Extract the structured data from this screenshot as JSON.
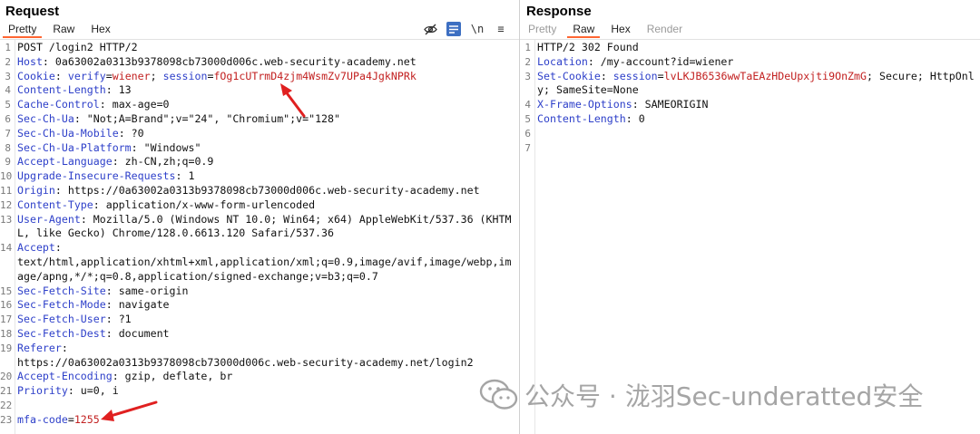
{
  "request": {
    "title": "Request",
    "tabs": [
      "Pretty",
      "Raw",
      "Hex"
    ],
    "active_tab": "Pretty",
    "toolbar": {
      "wrap_icon": "\\n",
      "menu_icon": "≡"
    },
    "lines": [
      {
        "n": "1",
        "parts": [
          {
            "t": "POST /login2 HTTP/2",
            "c": ""
          }
        ]
      },
      {
        "n": "2",
        "parts": [
          {
            "t": "Host",
            "c": "hk"
          },
          {
            "t": ": 0a63002a0313b9378098cb73000d006c.web-security-academy.net",
            "c": ""
          }
        ]
      },
      {
        "n": "3",
        "parts": [
          {
            "t": "Cookie",
            "c": "hk"
          },
          {
            "t": ": ",
            "c": ""
          },
          {
            "t": "verify",
            "c": "pk"
          },
          {
            "t": "=",
            "c": ""
          },
          {
            "t": "wiener",
            "c": "pv"
          },
          {
            "t": "; ",
            "c": ""
          },
          {
            "t": "session",
            "c": "pk"
          },
          {
            "t": "=",
            "c": ""
          },
          {
            "t": "fOg1cUTrmD4zjm4WsmZv7UPa4JgkNPRk",
            "c": "pv"
          }
        ]
      },
      {
        "n": "4",
        "parts": [
          {
            "t": "Content-Length",
            "c": "hk"
          },
          {
            "t": ": 13",
            "c": ""
          }
        ]
      },
      {
        "n": "5",
        "parts": [
          {
            "t": "Cache-Control",
            "c": "hk"
          },
          {
            "t": ": max-age=0",
            "c": ""
          }
        ]
      },
      {
        "n": "6",
        "parts": [
          {
            "t": "Sec-Ch-Ua",
            "c": "hk"
          },
          {
            "t": ": \"Not;A=Brand\";v=\"24\", \"Chromium\";v=\"128\"",
            "c": ""
          }
        ]
      },
      {
        "n": "7",
        "parts": [
          {
            "t": "Sec-Ch-Ua-Mobile",
            "c": "hk"
          },
          {
            "t": ": ?0",
            "c": ""
          }
        ]
      },
      {
        "n": "8",
        "parts": [
          {
            "t": "Sec-Ch-Ua-Platform",
            "c": "hk"
          },
          {
            "t": ": \"Windows\"",
            "c": ""
          }
        ]
      },
      {
        "n": "9",
        "parts": [
          {
            "t": "Accept-Language",
            "c": "hk"
          },
          {
            "t": ": zh-CN,zh;q=0.9",
            "c": ""
          }
        ]
      },
      {
        "n": "10",
        "parts": [
          {
            "t": "Upgrade-Insecure-Requests",
            "c": "hk"
          },
          {
            "t": ": 1",
            "c": ""
          }
        ]
      },
      {
        "n": "11",
        "parts": [
          {
            "t": "Origin",
            "c": "hk"
          },
          {
            "t": ": https://0a63002a0313b9378098cb73000d006c.web-security-academy.net",
            "c": ""
          }
        ]
      },
      {
        "n": "12",
        "parts": [
          {
            "t": "Content-Type",
            "c": "hk"
          },
          {
            "t": ": application/x-www-form-urlencoded",
            "c": ""
          }
        ]
      },
      {
        "n": "13",
        "parts": [
          {
            "t": "User-Agent",
            "c": "hk"
          },
          {
            "t": ": Mozilla/5.0 (Windows NT 10.0; Win64; x64) AppleWebKit/537.36 (KHTML, like Gecko) Chrome/128.0.6613.120 Safari/537.36",
            "c": ""
          }
        ]
      },
      {
        "n": "14",
        "parts": [
          {
            "t": "Accept",
            "c": "hk"
          },
          {
            "t": ":\ntext/html,application/xhtml+xml,application/xml;q=0.9,image/avif,image/webp,image/apng,*/*;q=0.8,application/signed-exchange;v=b3;q=0.7",
            "c": ""
          }
        ]
      },
      {
        "n": "15",
        "parts": [
          {
            "t": "Sec-Fetch-Site",
            "c": "hk"
          },
          {
            "t": ": same-origin",
            "c": ""
          }
        ]
      },
      {
        "n": "16",
        "parts": [
          {
            "t": "Sec-Fetch-Mode",
            "c": "hk"
          },
          {
            "t": ": navigate",
            "c": ""
          }
        ]
      },
      {
        "n": "17",
        "parts": [
          {
            "t": "Sec-Fetch-User",
            "c": "hk"
          },
          {
            "t": ": ?1",
            "c": ""
          }
        ]
      },
      {
        "n": "18",
        "parts": [
          {
            "t": "Sec-Fetch-Dest",
            "c": "hk"
          },
          {
            "t": ": document",
            "c": ""
          }
        ]
      },
      {
        "n": "19",
        "parts": [
          {
            "t": "Referer",
            "c": "hk"
          },
          {
            "t": ":\nhttps://0a63002a0313b9378098cb73000d006c.web-security-academy.net/login2",
            "c": ""
          }
        ]
      },
      {
        "n": "20",
        "parts": [
          {
            "t": "Accept-Encoding",
            "c": "hk"
          },
          {
            "t": ": gzip, deflate, br",
            "c": ""
          }
        ]
      },
      {
        "n": "21",
        "parts": [
          {
            "t": "Priority",
            "c": "hk"
          },
          {
            "t": ": u=0, i",
            "c": ""
          }
        ]
      },
      {
        "n": "22",
        "parts": [
          {
            "t": "",
            "c": ""
          }
        ]
      },
      {
        "n": "23",
        "parts": [
          {
            "t": "mfa-code",
            "c": "pk"
          },
          {
            "t": "=",
            "c": ""
          },
          {
            "t": "1255",
            "c": "pv"
          }
        ]
      }
    ]
  },
  "response": {
    "title": "Response",
    "tabs": [
      "Pretty",
      "Raw",
      "Hex",
      "Render"
    ],
    "active_tab": "Raw",
    "disabled_tabs": [
      "Pretty",
      "Render"
    ],
    "lines": [
      {
        "n": "1",
        "parts": [
          {
            "t": "HTTP/2 302 Found",
            "c": ""
          }
        ]
      },
      {
        "n": "2",
        "parts": [
          {
            "t": "Location",
            "c": "hk"
          },
          {
            "t": ": /my-account?id=wiener",
            "c": ""
          }
        ]
      },
      {
        "n": "3",
        "parts": [
          {
            "t": "Set-Cookie",
            "c": "hk"
          },
          {
            "t": ": ",
            "c": ""
          },
          {
            "t": "session",
            "c": "pk"
          },
          {
            "t": "=",
            "c": ""
          },
          {
            "t": "lvLKJB6536wwTaEAzHDeUpxjti9OnZmG",
            "c": "pv"
          },
          {
            "t": "; Secure; HttpOnly; SameSite=None",
            "c": ""
          }
        ]
      },
      {
        "n": "4",
        "parts": [
          {
            "t": "X-Frame-Options",
            "c": "hk"
          },
          {
            "t": ": SAMEORIGIN",
            "c": ""
          }
        ]
      },
      {
        "n": "5",
        "parts": [
          {
            "t": "Content-Length",
            "c": "hk"
          },
          {
            "t": ": 0",
            "c": ""
          }
        ]
      },
      {
        "n": "6",
        "parts": [
          {
            "t": "",
            "c": ""
          }
        ]
      },
      {
        "n": "7",
        "parts": [
          {
            "t": "",
            "c": ""
          }
        ]
      }
    ]
  },
  "watermark": {
    "text": "公众号 · 泷羽Sec-underatted安全"
  },
  "colors": {
    "header_key": "#2d3fc9",
    "param_value": "#c22020",
    "active_tab_underline": "#ff6633",
    "annotation_arrow": "#e02020"
  }
}
